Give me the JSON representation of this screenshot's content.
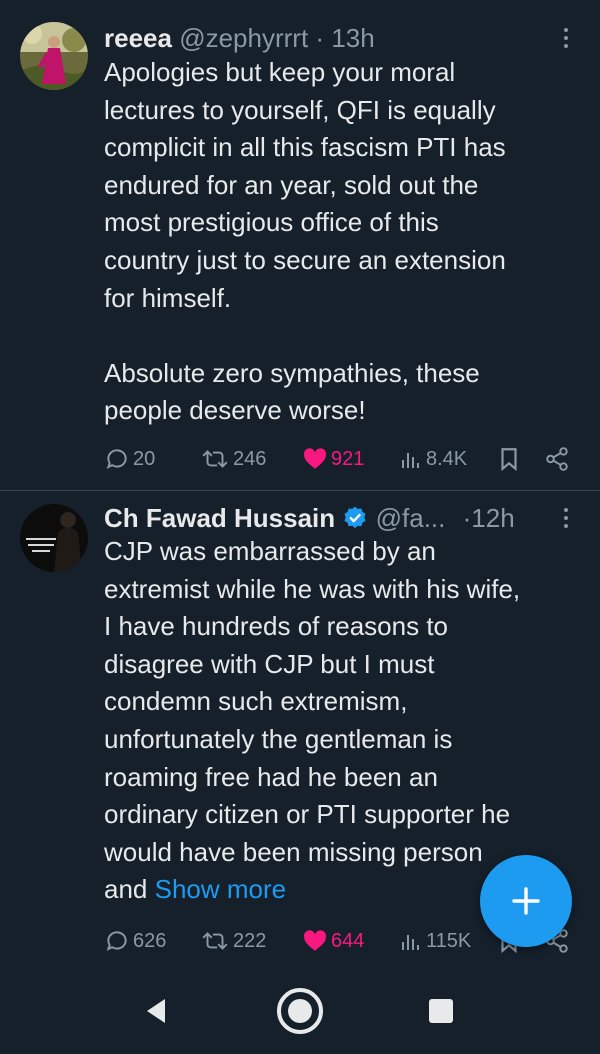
{
  "tweets": [
    {
      "name": "reeea",
      "handle": "@zephyrrrt",
      "separator": "·",
      "time": "13h",
      "text": "Apologies but keep your moral\nlectures to yourself, QFI is equally\ncomplicit in all this fascism PTI has\nendured for an year, sold out the\nmost prestigious office of this\ncountry just to secure an extension\nfor himself.\n\nAbsolute zero sympathies, these\npeople deserve worse!",
      "replies": "20",
      "reposts": "246",
      "likes": "921",
      "views": "8.4K"
    },
    {
      "name": "Ch Fawad Hussain",
      "handle": "@fa...",
      "separator": "·",
      "time": "12h",
      "verified": true,
      "text": "CJP was embarrassed by an\nextremist while he was with his wife,\nI have hundreds of reasons to\ndisagree with CJP but I must\ncondemn such extremism,\nunfortunately the gentleman is\nroaming free had he been an\nordinary citizen or PTI supporter he\nwould have been missing person\nand ",
      "show_more": "Show more",
      "replies": "626",
      "reposts": "222",
      "likes": "644",
      "views": "115K"
    }
  ],
  "colors": {
    "background": "#15202b",
    "text": "#e7e9ea",
    "secondary": "#8b98a5",
    "accent": "#1d9bf0",
    "like": "#f91880",
    "divider": "#38444d"
  },
  "icons": [
    "reply-icon",
    "repost-icon",
    "heart-icon",
    "views-icon",
    "bookmark-icon",
    "share-icon",
    "more-icon",
    "plus-icon",
    "back-icon",
    "home-icon",
    "recents-icon"
  ]
}
